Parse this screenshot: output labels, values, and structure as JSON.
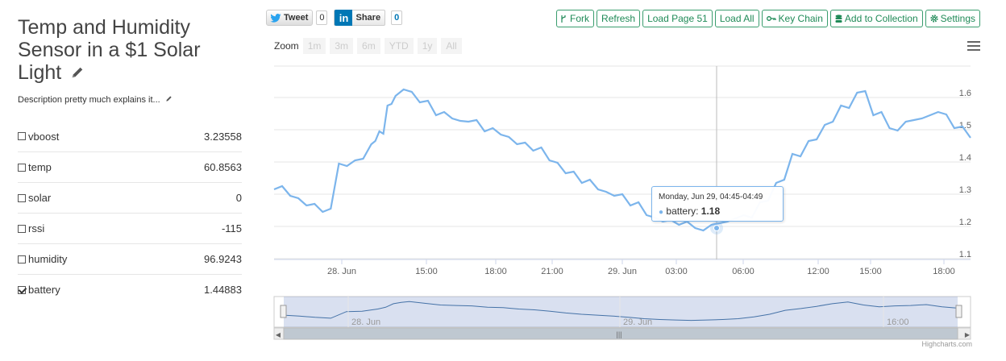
{
  "stream": {
    "title": "Temp and Humidity Sensor in a $1 Solar Light",
    "description": "Description pretty much explains it...",
    "fields": [
      {
        "name": "vboost",
        "value": "3.23558",
        "checked": false
      },
      {
        "name": "temp",
        "value": "60.8563",
        "checked": false
      },
      {
        "name": "solar",
        "value": "0",
        "checked": false
      },
      {
        "name": "rssi",
        "value": "-115",
        "checked": false
      },
      {
        "name": "humidity",
        "value": "96.9243",
        "checked": false
      },
      {
        "name": "battery",
        "value": "1.44883",
        "checked": true
      }
    ]
  },
  "social": {
    "tweet_label": "Tweet",
    "tweet_count": "0",
    "share_label": "Share",
    "share_count": "0"
  },
  "toolbar": {
    "fork": "Fork",
    "refresh": "Refresh",
    "load_page": "Load Page 51",
    "load_all": "Load All",
    "key_chain": "Key Chain",
    "add_collection": "Add to Collection",
    "settings": "Settings"
  },
  "zoom": {
    "label": "Zoom",
    "options": [
      "1m",
      "3m",
      "6m",
      "YTD",
      "1y",
      "All"
    ]
  },
  "tooltip": {
    "date": "Monday, Jun 29, 04:45-04:49",
    "series": "battery:",
    "value": "1.18"
  },
  "credits": "Highcharts.com",
  "colors": {
    "line": "#7cb5ec",
    "accent": "#3a9d6e"
  },
  "chart_data": {
    "type": "line",
    "series": [
      {
        "name": "battery",
        "x": [
          0,
          1,
          2,
          3,
          4,
          5,
          6,
          6.5,
          7,
          7.5,
          8,
          9,
          10,
          11,
          12,
          13,
          14,
          15,
          16,
          17,
          18,
          19,
          20,
          21,
          22,
          23,
          24,
          25,
          26,
          27,
          28,
          29,
          30,
          31,
          32,
          33,
          34,
          35,
          36,
          37,
          38,
          39,
          40,
          41,
          42,
          43
        ],
        "values": [
          1.3,
          1.28,
          1.25,
          1.23,
          1.38,
          1.39,
          1.44,
          1.48,
          1.56,
          1.59,
          1.61,
          1.57,
          1.53,
          1.52,
          1.51,
          1.48,
          1.47,
          1.44,
          1.42,
          1.39,
          1.35,
          1.32,
          1.3,
          1.28,
          1.25,
          1.22,
          1.2,
          1.19,
          1.18,
          1.19,
          1.2,
          1.22,
          1.26,
          1.32,
          1.41,
          1.45,
          1.5,
          1.56,
          1.6,
          1.53,
          1.49,
          1.51,
          1.52,
          1.54,
          1.49,
          1.46
        ]
      }
    ],
    "x_ticks": [
      "28. Jun",
      "15:00",
      "18:00",
      "21:00",
      "29. Jun",
      "03:00",
      "06:00",
      "12:00",
      "15:00",
      "18:00"
    ],
    "y_ticks": [
      "1.1",
      "1.2",
      "1.3",
      "1.4",
      "1.5",
      "1.6"
    ],
    "ylim": [
      1.1,
      1.6
    ],
    "navigator_labels": [
      "28. Jun",
      "29. Jun",
      "16:00"
    ]
  }
}
